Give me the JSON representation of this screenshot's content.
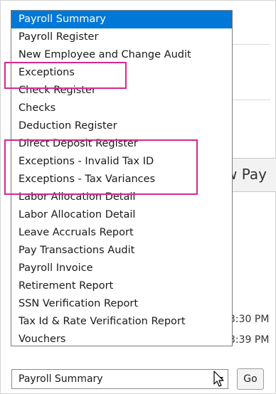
{
  "report_dropdown": {
    "options": [
      "Payroll Summary",
      "Payroll Register",
      "New Employee and Change Audit",
      "Exceptions",
      "Check Register",
      "Checks",
      "Deduction Register",
      "Direct Deposit Register",
      "Exceptions - Invalid Tax ID",
      "Exceptions - Tax Variances",
      "Labor Allocation Detail",
      "Labor Allocation Detail",
      "Leave Accruals Report",
      "Pay Transactions Audit",
      "Payroll Invoice",
      "Retirement Report",
      "SSN Verification Report",
      "Tax Id & Rate Verification Report",
      "Vouchers"
    ],
    "selected_value": "Payroll Summary"
  },
  "go_button_label": "Go",
  "background": {
    "button_fragment": "w Pay",
    "time_fragments": [
      "3:30 PM",
      "3:39 PM"
    ]
  },
  "colors": {
    "selection": "#0078d7",
    "annotation": "#d6288c"
  },
  "icons": {
    "select_arrow": "chevron-down-icon",
    "cursor": "mouse-pointer-icon"
  }
}
